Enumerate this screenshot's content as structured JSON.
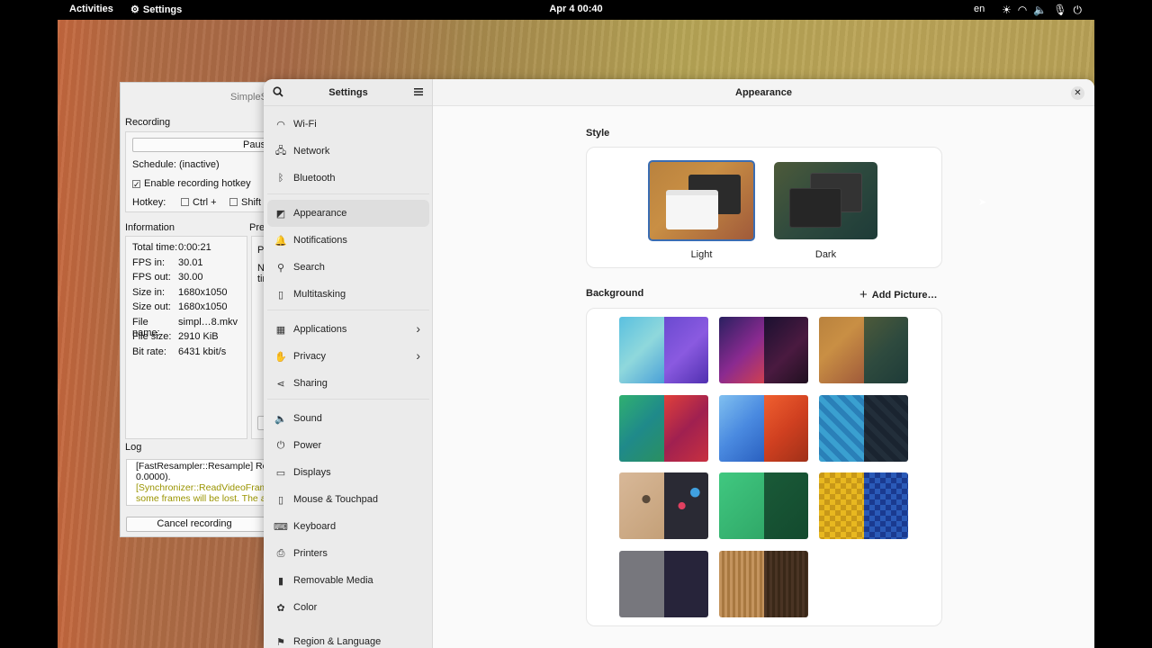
{
  "topbar": {
    "activities": "Activities",
    "app": "Settings",
    "clock": "Apr 4  00:40",
    "lang": "en",
    "tray_icons": [
      "brightness-icon",
      "wifi-icon",
      "volume-icon",
      "mic-icon",
      "power-icon"
    ]
  },
  "ssr": {
    "title": "SimpleS",
    "recording": "Recording",
    "pause": "Paus",
    "schedule": "Schedule: (inactive)",
    "hotkey_check": "Enable recording hotkey",
    "hotkey_label": "Hotkey:",
    "ctrl": "Ctrl +",
    "shift": "Shift +",
    "information": "Information",
    "preview": "Pre",
    "preview_p": "P",
    "preview_n": "N",
    "preview_ti": "tin",
    "info": [
      [
        "Total time:",
        "0:00:21"
      ],
      [
        "FPS in:",
        "30.01"
      ],
      [
        "FPS out:",
        "30.00"
      ],
      [
        "Size in:",
        "1680x1050"
      ],
      [
        "Size out:",
        "1680x1050"
      ],
      [
        "File name:",
        "simpl…8.mkv"
      ],
      [
        "File size:",
        "2910 KiB"
      ],
      [
        "Bit rate:",
        "6431 kbit/s"
      ]
    ],
    "log": "Log",
    "log_lines": [
      "[FastResampler::Resample] Re",
      "0.0000).",
      "[Synchronizer::ReadVideoFrame",
      "some frames will be lost. The au"
    ],
    "cancel": "Cancel recording"
  },
  "sidebar": {
    "title": "Settings",
    "items": [
      {
        "label": "Wi-Fi",
        "icon": "wifi-icon"
      },
      {
        "label": "Network",
        "icon": "network-icon"
      },
      {
        "label": "Bluetooth",
        "icon": "bluetooth-icon"
      },
      {
        "label": "Appearance",
        "icon": "appearance-icon"
      },
      {
        "label": "Notifications",
        "icon": "bell-icon"
      },
      {
        "label": "Search",
        "icon": "search-icon"
      },
      {
        "label": "Multitasking",
        "icon": "multitasking-icon"
      },
      {
        "label": "Applications",
        "icon": "apps-grid-icon"
      },
      {
        "label": "Privacy",
        "icon": "hand-icon"
      },
      {
        "label": "Sharing",
        "icon": "share-icon"
      },
      {
        "label": "Sound",
        "icon": "speaker-icon"
      },
      {
        "label": "Power",
        "icon": "power-icon"
      },
      {
        "label": "Displays",
        "icon": "display-icon"
      },
      {
        "label": "Mouse & Touchpad",
        "icon": "mouse-icon"
      },
      {
        "label": "Keyboard",
        "icon": "keyboard-icon"
      },
      {
        "label": "Printers",
        "icon": "printer-icon"
      },
      {
        "label": "Removable Media",
        "icon": "usb-icon"
      },
      {
        "label": "Color",
        "icon": "color-icon"
      },
      {
        "label": "Region & Language",
        "icon": "flag-icon"
      }
    ]
  },
  "main": {
    "title": "Appearance",
    "style_heading": "Style",
    "light": "Light",
    "dark": "Dark",
    "background_heading": "Background",
    "add_picture": "Add Picture…"
  },
  "colors": {
    "accent": "#3584e4",
    "selected_border": "#3a6db3"
  }
}
